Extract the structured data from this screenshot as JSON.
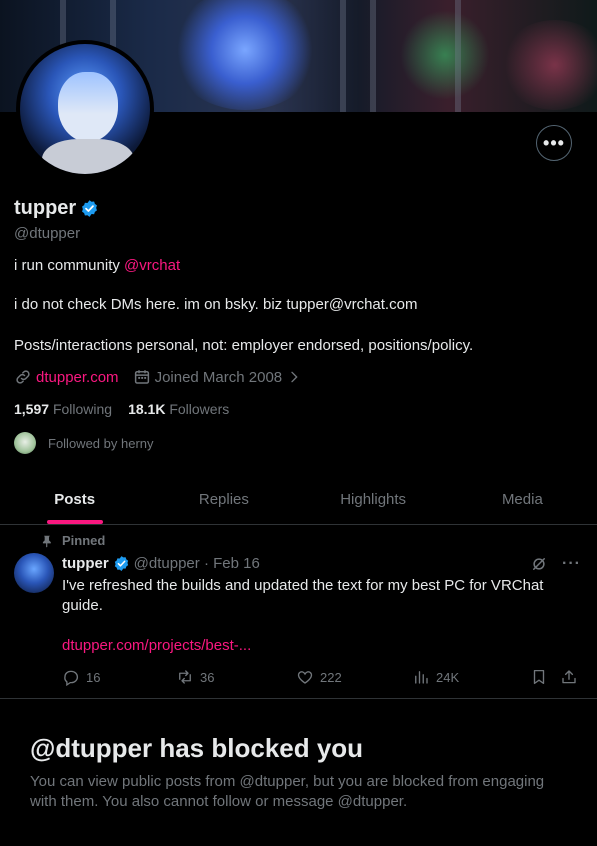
{
  "profile": {
    "display_name": "tupper",
    "handle": "@dtupper",
    "bio_line1_prefix": "i run community ",
    "bio_line1_mention": "@vrchat",
    "bio_line2": "i do not check DMs here. im on bsky. biz tupper@vrchat.com",
    "bio_line3": "Posts/interactions personal, not: employer endorsed, positions/policy.",
    "website": "dtupper.com",
    "joined": "Joined March 2008",
    "following_count": "1,597",
    "following_label": "Following",
    "followers_count": "18.1K",
    "followers_label": "Followers",
    "followed_by": "Followed by herny"
  },
  "buttons": {
    "more": "•••"
  },
  "tabs": [
    {
      "label": "Posts",
      "active": true
    },
    {
      "label": "Replies",
      "active": false
    },
    {
      "label": "Highlights",
      "active": false
    },
    {
      "label": "Media",
      "active": false
    }
  ],
  "pinned_post": {
    "pinned_label": "Pinned",
    "author": "tupper",
    "handle_date": "@dtupper · Feb 16",
    "text": "I've refreshed the builds and updated the text for my best PC for VRChat guide.",
    "link": "dtupper.com/projects/best-...",
    "replies": "16",
    "reposts": "36",
    "likes": "222",
    "views": "24K",
    "more": "···"
  },
  "blocked": {
    "title": "@dtupper has blocked you",
    "text": "You can view public posts from @dtupper, but you are blocked from engaging with them. You also cannot follow or message @dtupper."
  },
  "colors": {
    "accent": "#f91880",
    "verified": "#1d9bf0",
    "muted": "#71767b",
    "border": "#2f3336"
  }
}
